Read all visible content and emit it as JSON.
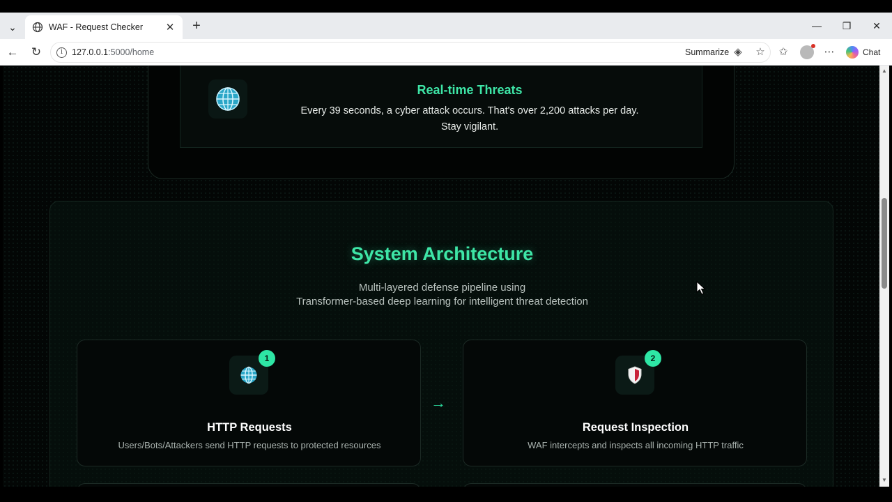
{
  "browser": {
    "tab_title": "WAF - Request Checker",
    "url_host": "127.0.0.1",
    "url_path": ":5000/home",
    "summarize_label": "Summarize",
    "chat_label": "Chat"
  },
  "threat": {
    "title": "Real-time Threats",
    "line1": "Every 39 seconds, a cyber attack occurs. That's over 2,200 attacks per day.",
    "line2": "Stay vigilant."
  },
  "architecture": {
    "title": "System Architecture",
    "subtitle_line1": "Multi-layered defense pipeline using",
    "subtitle_line2": "Transformer-based deep learning for intelligent threat detection",
    "steps": [
      {
        "number": "1",
        "title": "HTTP Requests",
        "description": "Users/Bots/Attackers send HTTP requests to protected resources",
        "icon": "globe-icon"
      },
      {
        "number": "2",
        "title": "Request Inspection",
        "description": "WAF intercepts and inspects all incoming HTTP traffic",
        "icon": "shield-icon"
      }
    ],
    "arrow": "→"
  },
  "colors": {
    "accent": "#3ee6a7",
    "badge": "#2ee6a5",
    "background": "#030605"
  }
}
